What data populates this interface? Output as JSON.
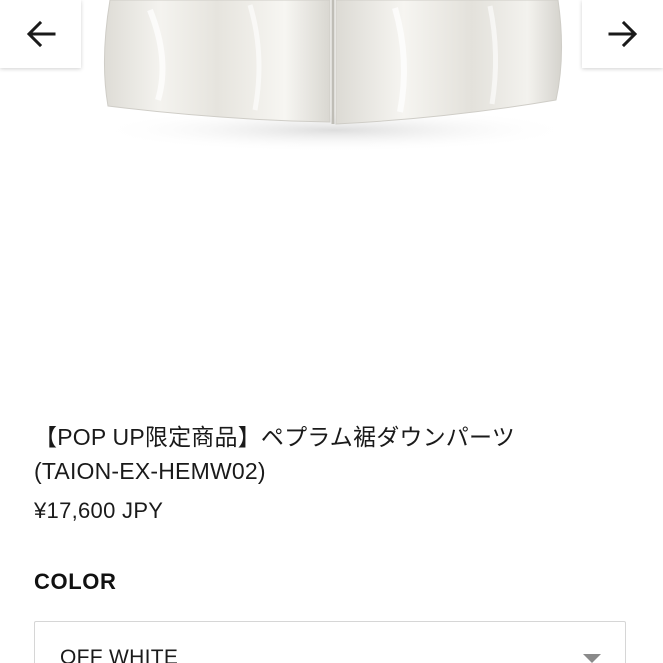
{
  "product": {
    "title_line1": "【POP UP限定商品】ペプラム裾ダウンパーツ",
    "title_line2": "(TAION-EX-HEMW02)",
    "price": "¥17,600 JPY"
  },
  "gallery": {
    "prev_icon": "arrow-left-icon",
    "next_icon": "arrow-right-icon"
  },
  "options": {
    "color_label": "COLOR",
    "color_selected": "OFF WHITE"
  },
  "colors": {
    "text": "#1a1a1a",
    "border": "#d6d6d6",
    "caret": "#8a8a8a"
  }
}
